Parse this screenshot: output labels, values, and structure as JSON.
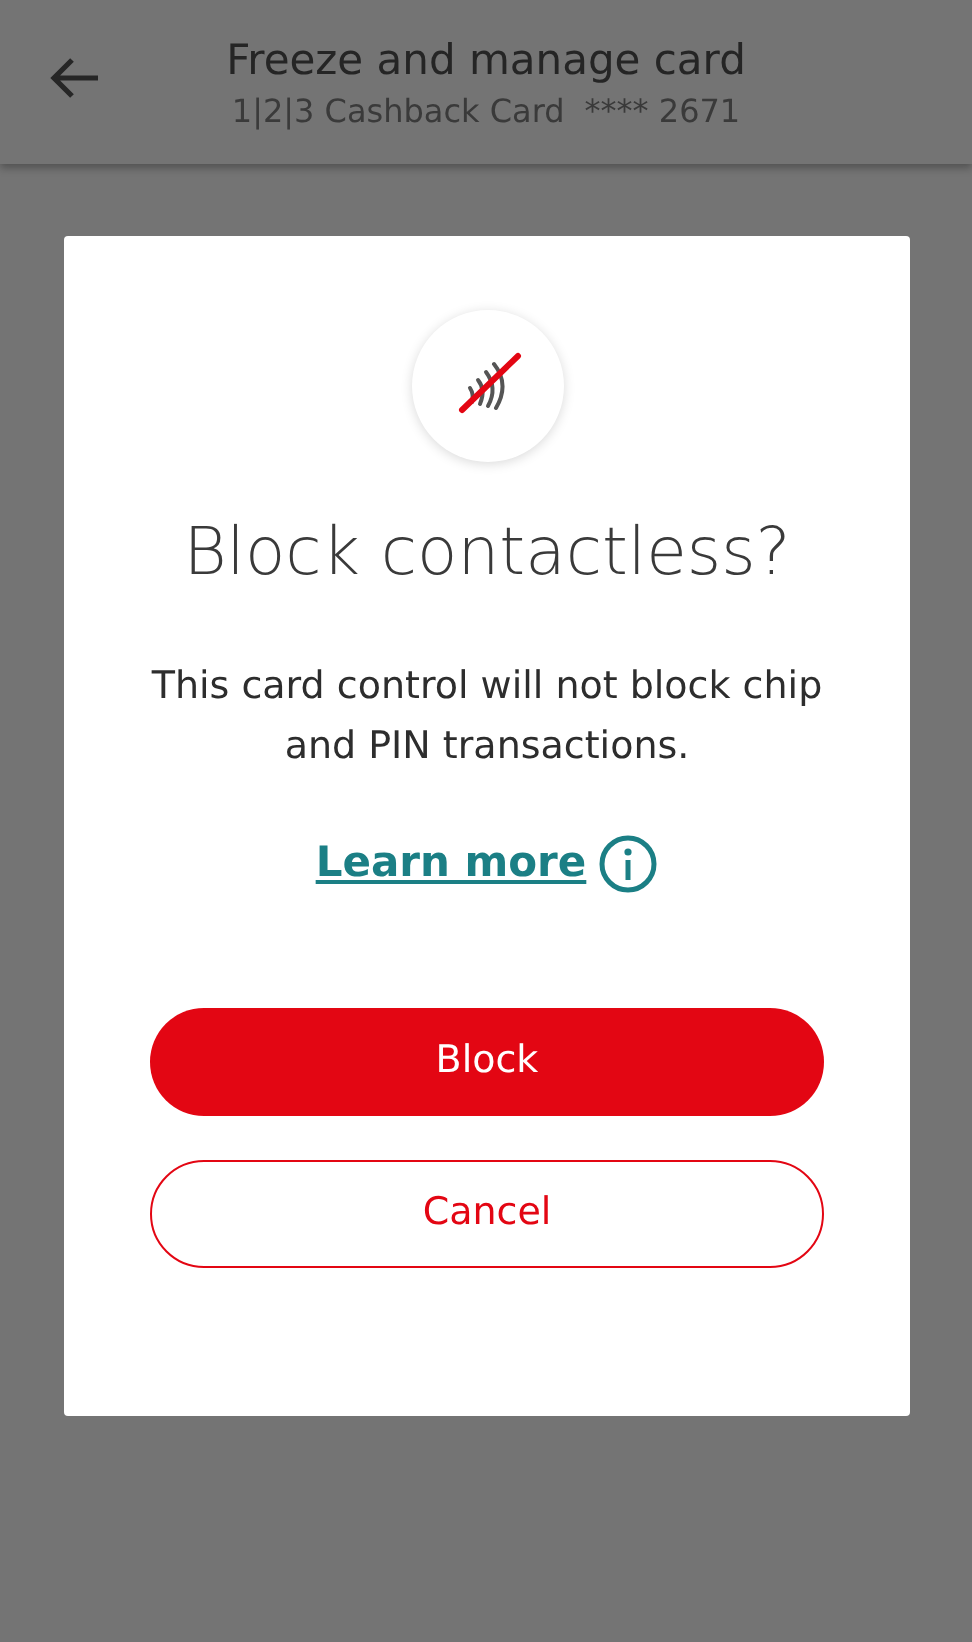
{
  "header": {
    "title": "Freeze and manage card",
    "card_name": "1|2|3 Cashback Card",
    "card_number": "**** 2671"
  },
  "dialog": {
    "title": "Block contactless?",
    "message": "This card control will not block chip and PIN transactions.",
    "link": "Learn more",
    "buttons": [
      {
        "label": "Block",
        "kind": "primary"
      },
      {
        "label": "Cancel",
        "kind": "secondary"
      }
    ]
  }
}
